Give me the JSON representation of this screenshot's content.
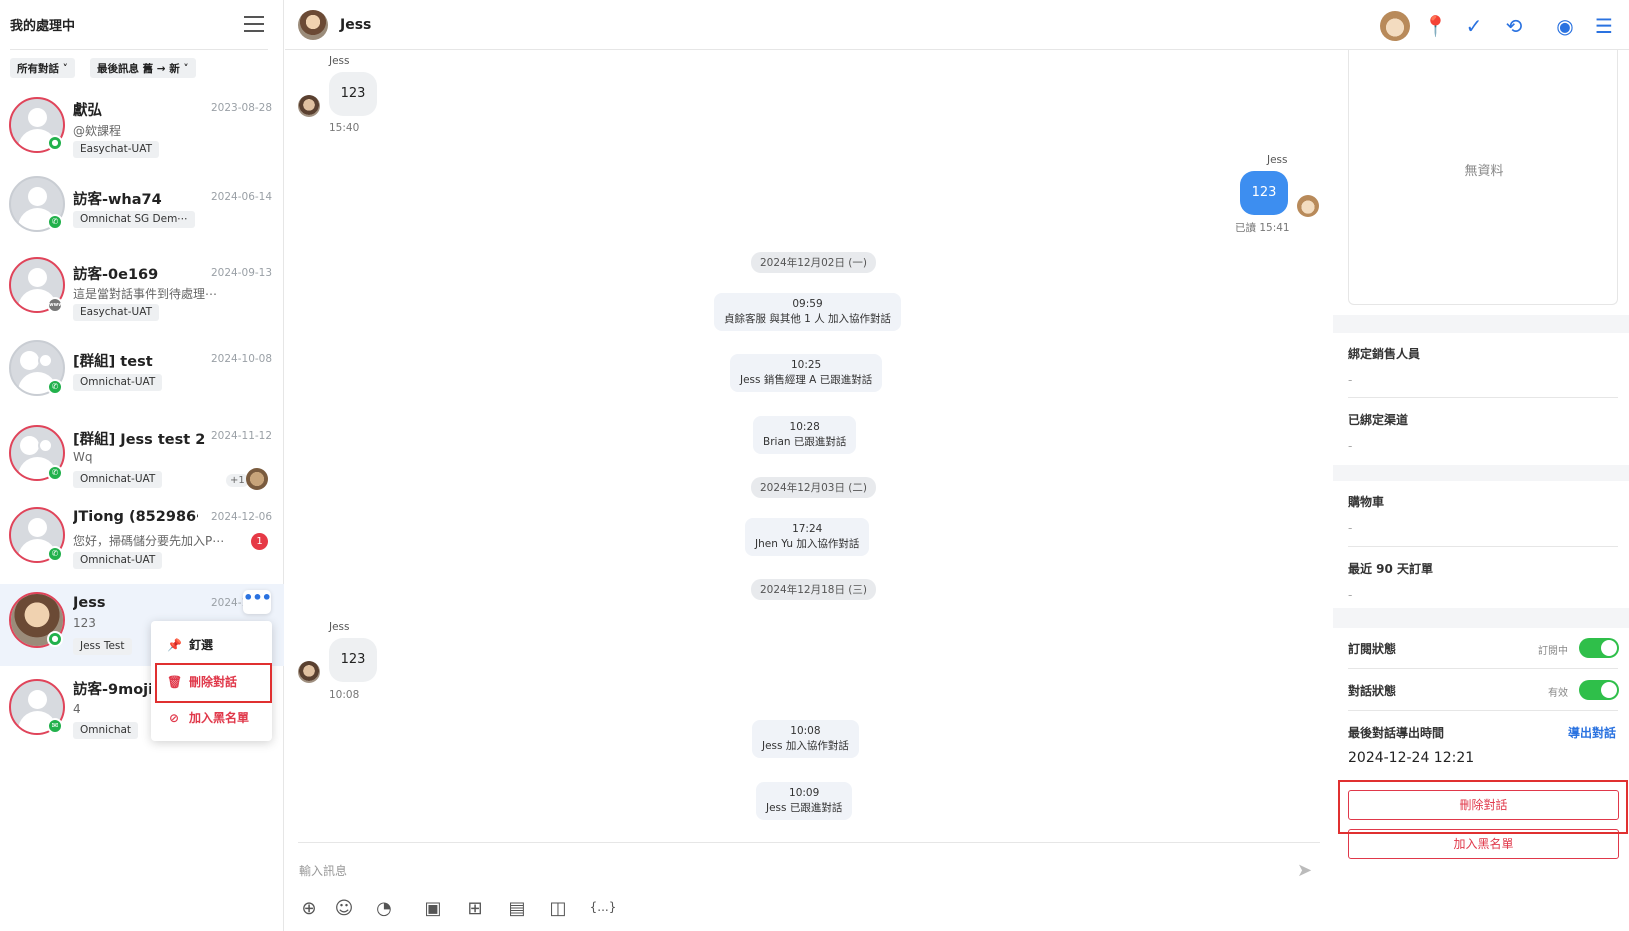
{
  "sidebar": {
    "title": "我的處理中",
    "filters": [
      "所有對話 ˅",
      "最後訊息 舊 → 新 ˅"
    ],
    "conversations": [
      {
        "name": "獻弘",
        "date": "2023-08-28",
        "msg": "@欸課程",
        "tag": "Easychat-UAT"
      },
      {
        "name": "訪客-wha74",
        "date": "2024-06-14",
        "msg": "",
        "tag": "Omnichat SG Dem⋯"
      },
      {
        "name": "訪客-0e169",
        "date": "2024-09-13",
        "msg": "這是當對話事件到待處理⋯",
        "tag": "Easychat-UAT"
      },
      {
        "name": "[群組] test",
        "date": "2024-10-08",
        "msg": "",
        "tag": "Omnichat-UAT"
      },
      {
        "name": "[群組] Jess test 2",
        "date": "2024-11-12",
        "msg": "Wq",
        "tag": "Omnichat-UAT",
        "extra": "+1"
      },
      {
        "name": "JTiong (852986⋯",
        "date": "2024-12-06",
        "msg": "您好，掃碼儲分要先加入P⋯",
        "tag": "Omnichat-UAT",
        "unread": "1"
      },
      {
        "name": "Jess",
        "date": "2024-1",
        "msg": "123",
        "tag": "Jess Test"
      },
      {
        "name": "訪客-9moji",
        "date": "",
        "msg": "4",
        "tag": "Omnichat"
      }
    ],
    "more_button": "•••",
    "context_menu": {
      "pin": "釘選",
      "delete": "刪除對話",
      "blacklist": "加入黑名單"
    }
  },
  "chat": {
    "contact_name": "Jess",
    "messages": [
      {
        "sender": "Jess",
        "text": "123",
        "time": "15:40"
      },
      {
        "sender": "Jess",
        "text": "123",
        "time": "已讀 15:41"
      },
      {
        "sender": "Jess",
        "text": "123",
        "time": "10:08"
      }
    ],
    "dates": [
      "2024年12月02日 (一)",
      "2024年12月03日 (二)",
      "2024年12月18日 (三)"
    ],
    "system": [
      {
        "time": "09:59",
        "text": "貞餘客服 與其他 1 人 加入協作對話"
      },
      {
        "time": "10:25",
        "text": "Jess 銷售經理 A  已跟進對話"
      },
      {
        "time": "10:28",
        "text": "Brian  已跟進對話"
      },
      {
        "time": "17:24",
        "text": "Jhen Yu 加入協作對話"
      },
      {
        "time": "10:08",
        "text": "Jess 加入協作對話"
      },
      {
        "time": "10:09",
        "text": "Jess  已跟進對話"
      }
    ],
    "input_placeholder": "輸入訊息",
    "toolbar_var": "{...}"
  },
  "panel": {
    "no_data": "無資料",
    "sales_label": "綁定銷售人員",
    "channel_label": "已綁定渠道",
    "cart_label": "購物車",
    "orders_label": "最近 90 天訂單",
    "dash": "-",
    "subscribe_label": "訂閱狀態",
    "subscribe_value": "訂閱中",
    "conv_status_label": "對話狀態",
    "conv_status_value": "有效",
    "last_export_label": "最後對話導出時間",
    "export_link": "導出對話",
    "last_export_time": "2024-12-24 12:21",
    "delete_button": "刪除對話",
    "blacklist_button": "加入黑名單"
  },
  "colors": {
    "accent": "#2a72e0",
    "danger": "#e0384a",
    "toggle": "#2fbf4a",
    "bubble_blue": "#3d8ef0"
  }
}
